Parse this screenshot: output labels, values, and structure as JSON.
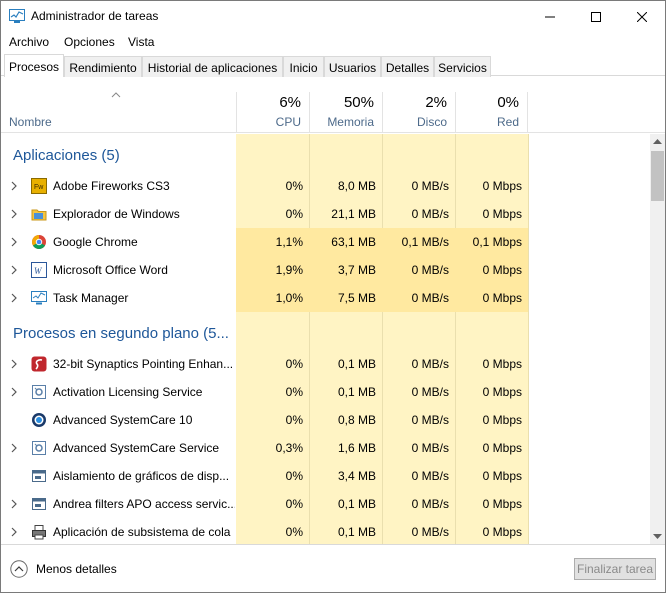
{
  "window": {
    "title": "Administrador de tareas"
  },
  "menu": [
    "Archivo",
    "Opciones",
    "Vista"
  ],
  "tabs": [
    "Procesos",
    "Rendimiento",
    "Historial de aplicaciones",
    "Inicio",
    "Usuarios",
    "Detalles",
    "Servicios"
  ],
  "header": {
    "name_label": "Nombre",
    "columns": [
      {
        "percent": "6%",
        "label": "CPU"
      },
      {
        "percent": "50%",
        "label": "Memoria"
      },
      {
        "percent": "2%",
        "label": "Disco"
      },
      {
        "percent": "0%",
        "label": "Red"
      }
    ]
  },
  "groups": {
    "apps": "Aplicaciones (5)",
    "background": "Procesos en segundo plano (5..."
  },
  "apps": [
    {
      "name": "Adobe Fireworks CS3",
      "icon": "fireworks-icon",
      "cpu": "0%",
      "mem": "8,0 MB",
      "disk": "0 MB/s",
      "net": "0 Mbps",
      "expandable": true
    },
    {
      "name": "Explorador de Windows",
      "icon": "folder-icon",
      "cpu": "0%",
      "mem": "21,1 MB",
      "disk": "0 MB/s",
      "net": "0 Mbps",
      "expandable": true
    },
    {
      "name": "Google Chrome",
      "icon": "chrome-icon",
      "cpu": "1,1%",
      "mem": "63,1 MB",
      "disk": "0,1 MB/s",
      "net": "0,1 Mbps",
      "expandable": true
    },
    {
      "name": "Microsoft Office Word",
      "icon": "word-icon",
      "cpu": "1,9%",
      "mem": "3,7 MB",
      "disk": "0 MB/s",
      "net": "0 Mbps",
      "expandable": true
    },
    {
      "name": "Task Manager",
      "icon": "task-manager-icon",
      "cpu": "1,0%",
      "mem": "7,5 MB",
      "disk": "0 MB/s",
      "net": "0 Mbps",
      "expandable": true
    }
  ],
  "background": [
    {
      "name": "32-bit Synaptics Pointing Enhan...",
      "icon": "synaptics-icon",
      "cpu": "0%",
      "mem": "0,1 MB",
      "disk": "0 MB/s",
      "net": "0 Mbps",
      "expandable": true
    },
    {
      "name": "Activation Licensing Service",
      "icon": "service-icon",
      "cpu": "0%",
      "mem": "0,1 MB",
      "disk": "0 MB/s",
      "net": "0 Mbps",
      "expandable": true
    },
    {
      "name": "Advanced SystemCare 10",
      "icon": "systemcare-icon",
      "cpu": "0%",
      "mem": "0,8 MB",
      "disk": "0 MB/s",
      "net": "0 Mbps",
      "expandable": false
    },
    {
      "name": "Advanced SystemCare Service",
      "icon": "service-icon",
      "cpu": "0,3%",
      "mem": "1,6 MB",
      "disk": "0 MB/s",
      "net": "0 Mbps",
      "expandable": true
    },
    {
      "name": "Aislamiento de gráficos de disp...",
      "icon": "window-icon",
      "cpu": "0%",
      "mem": "3,4 MB",
      "disk": "0 MB/s",
      "net": "0 Mbps",
      "expandable": false
    },
    {
      "name": "Andrea filters APO access servic...",
      "icon": "window-icon",
      "cpu": "0%",
      "mem": "0,1 MB",
      "disk": "0 MB/s",
      "net": "0 Mbps",
      "expandable": true
    },
    {
      "name": "Aplicación de subsistema de cola",
      "icon": "printer-icon",
      "cpu": "0%",
      "mem": "0,1 MB",
      "disk": "0 MB/s",
      "net": "0 Mbps",
      "expandable": true
    }
  ],
  "footer": {
    "less_details": "Menos detalles",
    "end_task": "Finalizar tarea"
  },
  "colors": {
    "group_header": "#1e5799",
    "heat_light": "#fff4c4",
    "heat_medium": "#ffe9a0",
    "column_label": "#4d6a8a"
  }
}
